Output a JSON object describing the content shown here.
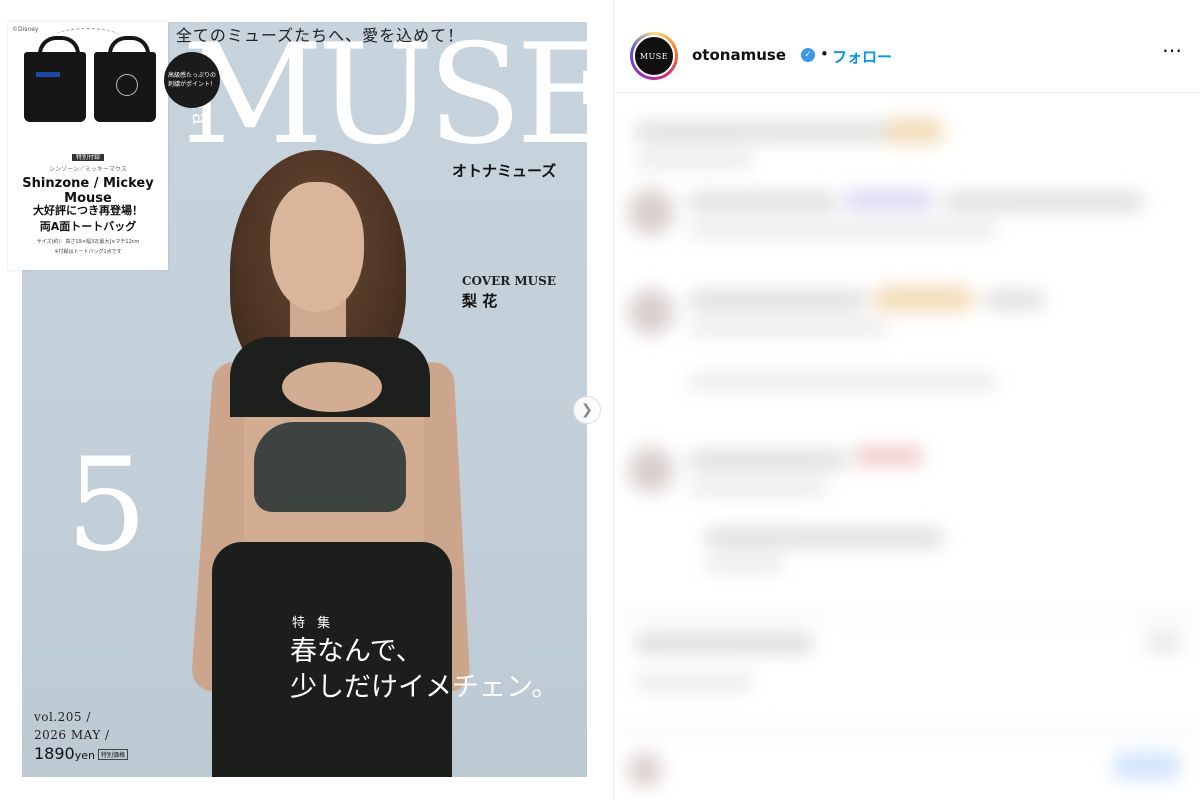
{
  "cover": {
    "tagline": "全てのミューズたちへ、愛を込めて！",
    "masthead": "MUSE",
    "masthead_sub": "otona",
    "brand_kana": "オトナミューズ",
    "issue_number": "5",
    "cover_muse_label": "COVER MUSE",
    "cover_muse_name": "梨 花",
    "feature_label": "特 集",
    "feature_headline_line1": "春なんで、",
    "feature_headline_line2": "少しだけイメチェン。",
    "issue_vol": "vol.205 /",
    "issue_date": "2026 MAY /",
    "issue_price": "1890",
    "issue_price_unit": "yen",
    "price_tag": "特別価格"
  },
  "bonus": {
    "disney_label": "©Disney",
    "tag_top": "特別付録",
    "tag_sub": "シンゾーン／ミッキーマウス",
    "title": "Shinzone / Mickey Mouse",
    "line1": "大好評につき再登場！",
    "line2": "両A面トートバッグ",
    "size_note": "サイズ(約)：高さ19×幅32[最大]×マチ12cm",
    "bag_note": "※付録はトートバッグ1点です",
    "badge": "高級感たっぷりの刺繍がポイント！"
  },
  "carousel": {
    "next_icon": "chevron-right-icon"
  },
  "post_header": {
    "avatar_text": "MUSE",
    "username": "otonamuse",
    "separator": "•",
    "follow_label": "フォロー",
    "more_label": "⋯"
  },
  "colors": {
    "follow_blue": "#0095f6",
    "verified_blue": "#3897f0",
    "cover_bg": "#c5d1db"
  }
}
